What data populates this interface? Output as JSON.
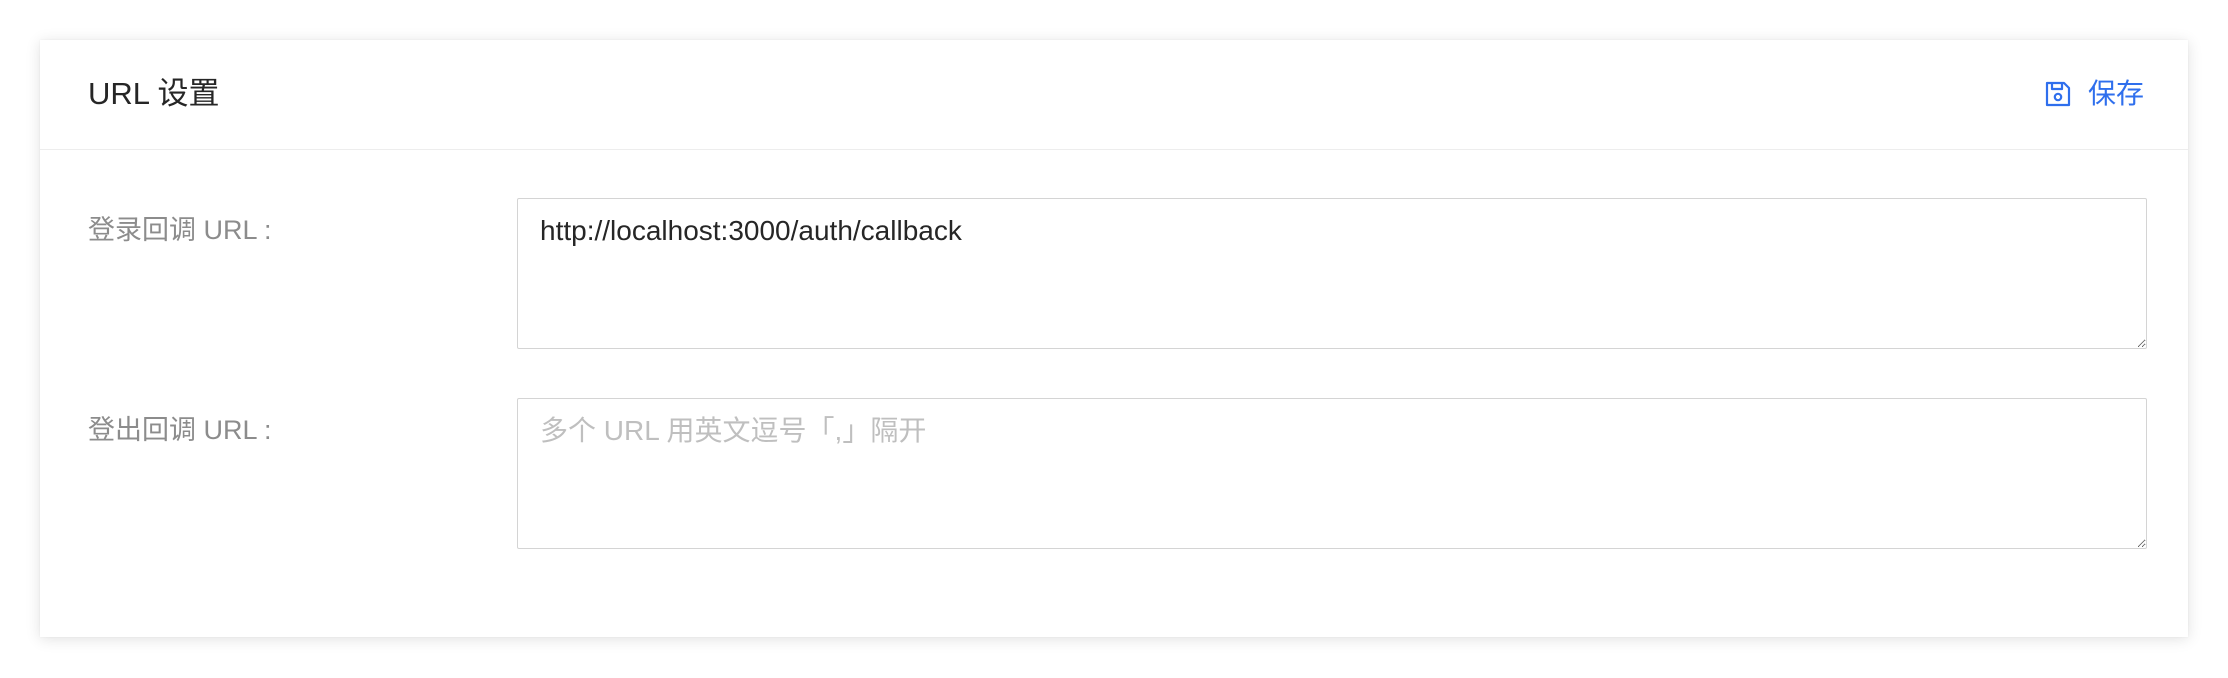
{
  "card": {
    "title": "URL 设置",
    "save_label": "保存",
    "save_icon": "save-icon"
  },
  "fields": {
    "login_callback": {
      "label": "登录回调 URL :",
      "value": "http://localhost:3000/auth/callback",
      "placeholder": ""
    },
    "logout_callback": {
      "label": "登出回调 URL :",
      "value": "",
      "placeholder": "多个 URL 用英文逗号「,」隔开"
    }
  },
  "colors": {
    "accent": "#2f6fed",
    "label": "#8c8c8c",
    "text": "#262626",
    "border": "#d4d4d4",
    "placeholder": "#bfbfbf"
  }
}
